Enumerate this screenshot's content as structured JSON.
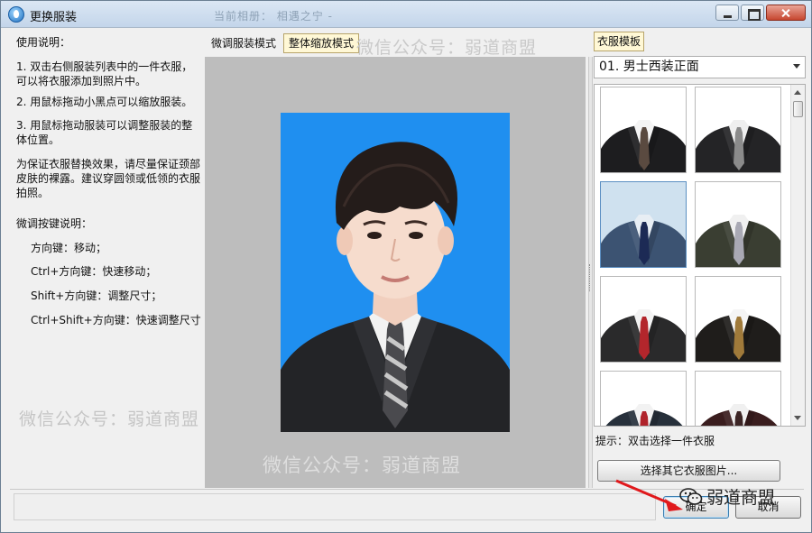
{
  "window": {
    "title": "更换服装",
    "ghost_title": "当前相册：   相遇之宁 -"
  },
  "instructions": {
    "heading": "使用说明：",
    "step1": "1. 双击右侧服装列表中的一件衣服，可以将衣服添加到照片中。",
    "step2": "2. 用鼠标拖动小黑点可以缩放服装。",
    "step3": "3. 用鼠标拖动服装可以调整服装的整体位置。",
    "note": "为保证衣服替换效果，请尽量保证颈部皮肤的裸露。建议穿圆领或低领的衣服拍照。",
    "keys_heading": "微调按键说明：",
    "key1": "方向键：移动；",
    "key2": "Ctrl+方向键：快速移动；",
    "key3": "Shift+方向键：调整尺寸；",
    "key4": "Ctrl+Shift+方向键：快速调整尺寸"
  },
  "mode_tabs": [
    {
      "label": "微调服装模式",
      "active": false
    },
    {
      "label": "整体缩放模式",
      "active": true
    }
  ],
  "watermarks": {
    "top": "微信公众号：弱道商盟",
    "left": "微信公众号：弱道商盟",
    "bottom": "微信公众号：弱道商盟",
    "corner": "弱道商盟"
  },
  "templates": {
    "tab_label": "衣服模板",
    "selected": "01. 男士西装正面",
    "hint": "提示：双击选择一件衣服",
    "other_button": "选择其它衣服图片...",
    "items": [
      {
        "name": "black-suit-striped-tie",
        "suit": "#1d1d1f",
        "shirt": "#f4f4f4",
        "tie": "#5a4a40",
        "bg": "#ffffff"
      },
      {
        "name": "black-suit-grey-tie",
        "suit": "#242426",
        "shirt": "#efefef",
        "tie": "#8b8b8b",
        "bg": "#ffffff"
      },
      {
        "name": "blue-tweed-suit-navy-tie",
        "suit": "#3c5372",
        "shirt": "#e8eef4",
        "tie": "#1c2a55",
        "bg": "#cfe1ef"
      },
      {
        "name": "olive-suit-silver-tie",
        "suit": "#3a3e32",
        "shirt": "#f0f0f0",
        "tie": "#a9a9b4",
        "bg": "#ffffff"
      },
      {
        "name": "black-suit-red-tie",
        "suit": "#2a2a2b",
        "shirt": "#f3f3f3",
        "tie": "#b3262c",
        "bg": "#ffffff"
      },
      {
        "name": "black-suit-gold-tie",
        "suit": "#1f1d1b",
        "shirt": "#f5f5f5",
        "tie": "#a07a3a",
        "bg": "#ffffff"
      },
      {
        "name": "navy-suit-red-tie",
        "suit": "#27303b",
        "shirt": "#f2f2f2",
        "tie": "#b0232b",
        "bg": "#ffffff"
      },
      {
        "name": "maroon-suit-dark-tie",
        "suit": "#3a1d1e",
        "shirt": "#f0f0f0",
        "tie": "#3c2525",
        "bg": "#ffffff"
      }
    ]
  },
  "buttons": {
    "ok": "确定",
    "cancel": "取消"
  },
  "colors": {
    "photo_background": "#1f8ff0",
    "active_tab": "#fff8d6",
    "arrow": "#e0191c"
  }
}
